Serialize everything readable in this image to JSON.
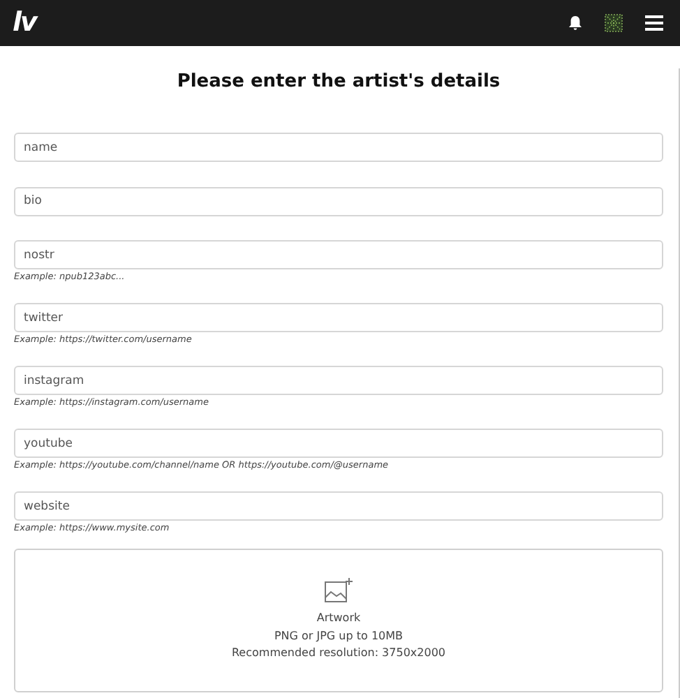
{
  "navbar": {
    "logo": "lv"
  },
  "title": "Please enter the artist's details",
  "fields": [
    {
      "placeholder": "name"
    },
    {
      "placeholder": "bio"
    },
    {
      "placeholder": "nostr",
      "hint": "Example: npub123abc..."
    },
    {
      "placeholder": "twitter",
      "hint": "Example: https://twitter.com/username"
    },
    {
      "placeholder": "instagram",
      "hint": "Example: https://instagram.com/username"
    },
    {
      "placeholder": "youtube",
      "hint": "Example: https://youtube.com/channel/name OR https://youtube.com/@username"
    },
    {
      "placeholder": "website",
      "hint": "Example: https://www.mysite.com"
    }
  ],
  "upload": {
    "label": "Artwork",
    "formats": "PNG or JPG up to 10MB",
    "resolution": "Recommended resolution: 3750x2000"
  }
}
